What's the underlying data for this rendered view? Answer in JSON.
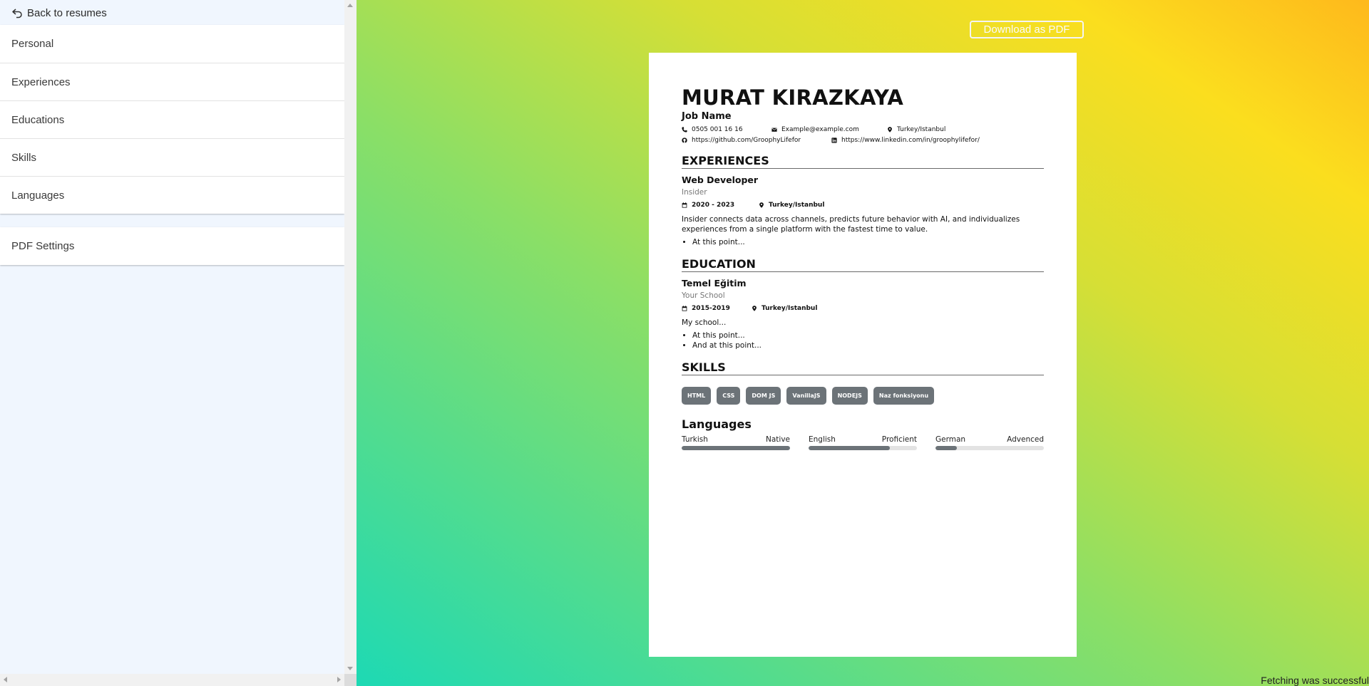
{
  "sidebar": {
    "back_label": "Back to resumes",
    "sections": [
      "Personal",
      "Experiences",
      "Educations",
      "Skills",
      "Languages"
    ],
    "pdf_section": "PDF Settings"
  },
  "preview": {
    "download_label": "Download as PDF",
    "status": "Fetching was successful"
  },
  "resume": {
    "name": "MURAT KIRAZKAYA",
    "job": "Job Name",
    "phone": "0505 001 16 16",
    "email": "Example@example.com",
    "location": "Turkey/Istanbul",
    "github": "https://github.com/GroophyLifefor",
    "linkedin": "https://www.linkedin.com/in/groophylifefor/",
    "experience_heading": "EXPERIENCES",
    "experience": {
      "title": "Web Developer",
      "company": "Insider",
      "dates": "2020 - 2023",
      "location": "Turkey/Istanbul",
      "description": "Insider connects data across channels, predicts future behavior with AI, and individualizes experiences from a single platform with the fastest time to value.",
      "bullets": [
        "At this point..."
      ]
    },
    "education_heading": "EDUCATION",
    "education": {
      "title": "Temel Eğitim",
      "school": "Your School",
      "dates": "2015-2019",
      "location": "Turkey/Istanbul",
      "description": "My school...",
      "bullets": [
        "At this point...",
        "And at this point..."
      ]
    },
    "skills_heading": "SKILLS",
    "skills": [
      "HTML",
      "CSS",
      "DOM JS",
      "VanillaJS",
      "NODEJS",
      "Naz fonksiyonu"
    ],
    "languages_heading": "Languages",
    "languages": [
      {
        "name": "Turkish",
        "level": "Native",
        "progress": 1.0
      },
      {
        "name": "English",
        "level": "Proficient",
        "progress": 0.75
      },
      {
        "name": "German",
        "level": "Advenced",
        "progress": 0.2
      }
    ]
  },
  "colors": {
    "sidebar_bg": "#f0f6fe",
    "tag_bg": "#6c7378",
    "gradient": [
      "#1dd9b4",
      "#8bdf66",
      "#d6df35",
      "#fbde1e",
      "#feb91c"
    ]
  }
}
